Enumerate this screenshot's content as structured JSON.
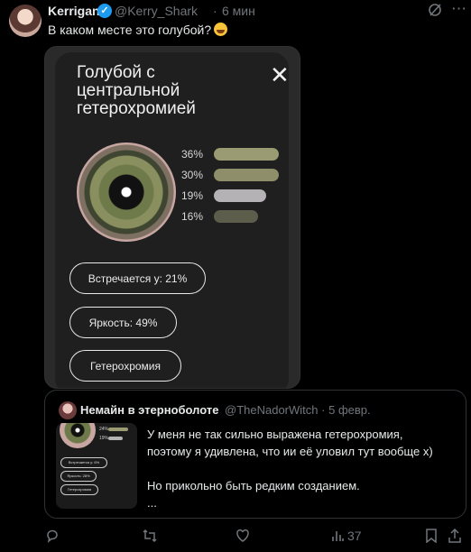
{
  "tweet": {
    "author": "Kerrigan",
    "handle": "@Kerry_Shark",
    "separator": "·",
    "time": "6 мин",
    "text": "В каком месте это голубой?",
    "emoji": "rolling-on-the-floor-laughing-emoji"
  },
  "card": {
    "title": "Голубой с центральной гетерохромией",
    "close_glyph": "✕",
    "stats": [
      {
        "label": "36%",
        "value": 36,
        "color": "#9a9a73"
      },
      {
        "label": "30%",
        "value": 30,
        "color": "#8e8e6a"
      },
      {
        "label": "19%",
        "value": 19,
        "color": "#b4b2b4"
      },
      {
        "label": "16%",
        "value": 16,
        "color": "#5c5d4a"
      }
    ],
    "pills": [
      "Встречается у: 21%",
      "Яркость: 49%",
      "Гетерохромия"
    ]
  },
  "quote": {
    "author": "Немайн в этерноболоте",
    "handle": "@TheNadorWitch",
    "separator": "·",
    "date": "5 февр.",
    "text_line1": "У меня не так сильно выражена гетерохромия,",
    "text_line2": "поэтому я удивлена, что ии её уловил тут вообще х)",
    "text_line3": "Но прикольно быть редким созданием.",
    "text_more": "...",
    "thumb_stats": [
      "24%",
      "19%"
    ],
    "thumb_pills": [
      "Встречается у: 6%",
      "Яркость: 28%",
      "Гетерохромия"
    ]
  },
  "actions": {
    "views": "37"
  }
}
